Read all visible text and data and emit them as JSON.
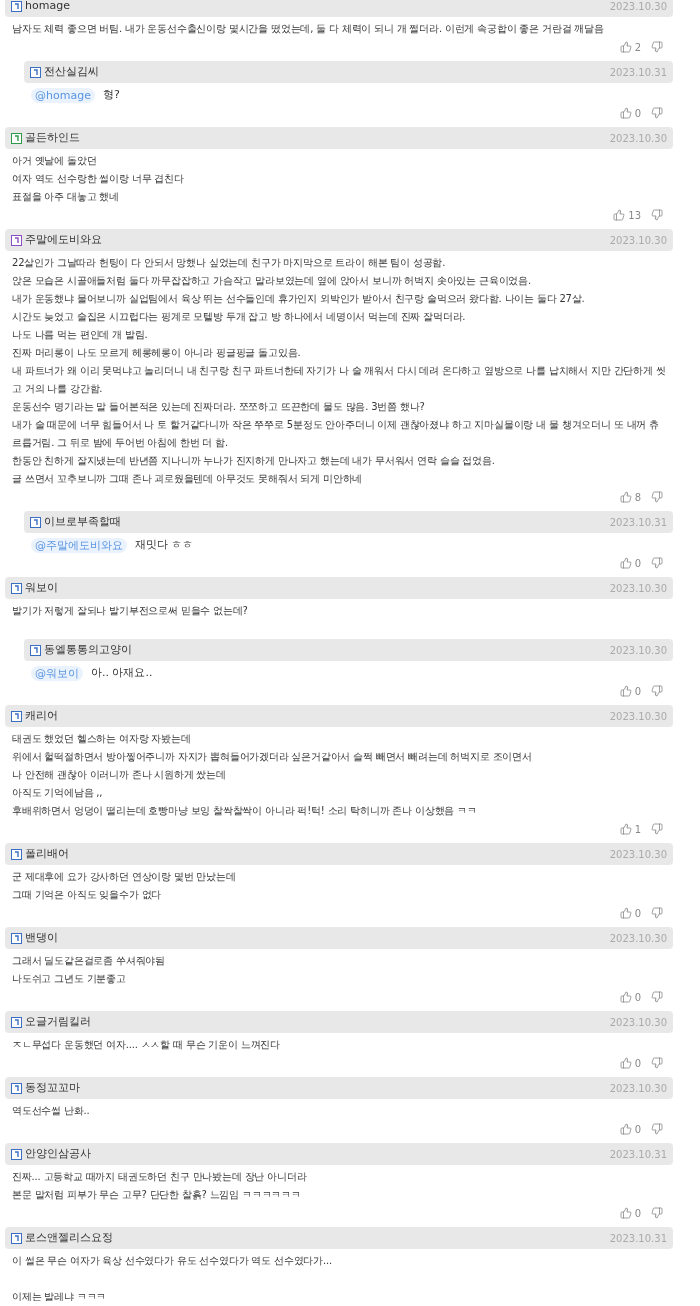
{
  "comments": [
    {
      "author": {
        "name": "homage",
        "color": "#3b6fc4"
      },
      "date": "2023.10.30",
      "lines": [
        "남자도 체력 좋으면 버팀. 내가 운동선수출신이랑 몇시간을 떴었는데, 둘 다 체력이 되니 개 쩔더라. 이런게 속궁합이 좋은 거란걸 깨달음"
      ],
      "likes": "2",
      "replies": [
        {
          "author": {
            "name": "전산실김씨",
            "color": "#3b6fc4"
          },
          "date": "2023.10.31",
          "mention": "@homage",
          "text": "형?",
          "likes": "0"
        }
      ]
    },
    {
      "author": {
        "name": "골든하인드",
        "color": "#2e9b4a"
      },
      "date": "2023.10.30",
      "lines": [
        "아거 옛날에 돌았던",
        "여자 역도 선수랑한 썰이랑 너무 겹친다",
        "표절을 아주 대놓고 했네"
      ],
      "likes": "13"
    },
    {
      "author": {
        "name": "주말에도비와요",
        "color": "#8a4fc4"
      },
      "date": "2023.10.30",
      "lines": [
        "22살인가 그날따라 헌팅이 다 안되서 망했나 싶었는데 친구가 마지막으로 트라이 해본 팀이 성공함.",
        "앉은 모습은 시골애들처럼 둘다 까무잡잡하고 가슴작고 말라보였는데 옆에 앉아서 보니까 허벅지 솟아있는 근육이었음.",
        "내가 운동했냐 물어보니까 실업팀에서 육상 뛰는 선수들인데 휴가인지 외박인가 받아서 친구랑 술먹으러 왔다함. 나이는 둘다 27살.",
        "시간도 늦었고 술집은 시끄럽다는 핑계로 모텔방 두개 잡고 방 하나에서 네명이서 먹는데 진짜 잘먹더라.",
        "나도 나름 먹는 편인데 개 발림.",
        "진짜 머리롱이 나도 모르게 헤롱헤롱이 아니라 핑글핑글 돌고있음.",
        "내 파트너가 왜 이리 못먹냐고 놀리더니 내 친구랑 친구 파트너한테 자기가 나 술 깨워서 다시 데려 온다하고 옆방으로 나를 납치해서 지만 간단하게 씻고 거의 나를 강간함.",
        "운동선수 명기라는 말 들어본적은 있는데 진짜더라. 쪼쪼하고 뜨끈한데 물도 많음. 3번쯤 했나?",
        "내가 술 때문에 너무 힘들어서 나 토 할거같다니까 작은 쭈쭈로 5분정도 안아주더니 이제 괜찮아졌냐 하고 지마실물이랑 내 물 챙겨오더니 또 내꺼 츄르릅거림. 그 뒤로 밤에 두어번 아침에 한번 더 함.",
        "한동안 친하게 잘지냈는데 반년쯤 지나니까 누나가 진지하게 만나자고 했는데 내가 무서워서 연락 슬슬 접었음.",
        "글 쓰면서 꼬추보니까 그때 존나 괴로웠을텐데 아무것도 못해줘서 되게 미안하네"
      ],
      "likes": "8",
      "replies": [
        {
          "author": {
            "name": "이브로부족할때",
            "color": "#3b6fc4"
          },
          "date": "2023.10.31",
          "mention": "@주말에도비와요",
          "text": "재밋다 ㅎㅎ",
          "likes": "0"
        }
      ]
    },
    {
      "author": {
        "name": "워보이",
        "color": "#3b6fc4"
      },
      "date": "2023.10.30",
      "lines": [
        "발기가 저렇게 잘되나 발기부전으로써 믿을수 없는데?"
      ],
      "replies": [
        {
          "author": {
            "name": "동엘통통의고양이",
            "color": "#3b6fc4"
          },
          "date": "2023.10.30",
          "mention": "@워보이",
          "text": "아.. 아재요..",
          "likes": "0"
        }
      ]
    },
    {
      "author": {
        "name": "캐리어",
        "color": "#3b6fc4"
      },
      "date": "2023.10.30",
      "lines": [
        "태권도 했었던 헬스하는 여자랑 자봤는데",
        "위에서 헐떡절하면서 방아찧어주니까 자지가 뽑혀들어가겠더라 싶은거같아서 슬쩍 빼면서 빼려는데 허벅지로 조이면서",
        "나 안전해 괜찮아 이러니까 존나 시원하게 쌌는데",
        "아직도 기억에남음 ,,",
        "후배위하면서 엉덩이 떨리는데 호빵마냥 보잉 찰싹찰싹이 아니라 퍽!턱! 소리 탁히니까 존나 이상했음 ㅋㅋ"
      ],
      "likes": "1"
    },
    {
      "author": {
        "name": "폴리배어",
        "color": "#3b6fc4"
      },
      "date": "2023.10.30",
      "lines": [
        "군 제대후에 요가 강사하던 연상이랑 몇번 만났는데",
        "그때 기억은 아직도 잊을수가 없다"
      ],
      "likes": "0"
    },
    {
      "author": {
        "name": "밴댕이",
        "color": "#3b6fc4"
      },
      "date": "2023.10.30",
      "lines": [
        "그래서 딜도같은걸로좀 쑤셔줘야됨",
        "나도쉬고 그년도 기분좋고"
      ],
      "likes": "0"
    },
    {
      "author": {
        "name": "오글거림킬러",
        "color": "#3b6fc4"
      },
      "date": "2023.10.30",
      "lines": [
        "ㅈㄴ무섭다 운동했던 여자.... ㅅㅅ할 때 무슨 기운이 느껴진다"
      ],
      "likes": "0"
    },
    {
      "author": {
        "name": "동정꼬꼬마",
        "color": "#3b6fc4"
      },
      "date": "2023.10.30",
      "lines": [
        "역도선수썰 난화.."
      ],
      "likes": "0"
    },
    {
      "author": {
        "name": "안양인삼공사",
        "color": "#3b6fc4"
      },
      "date": "2023.10.31",
      "lines": [
        "진짜... 고등학교 때까지 태권도하던 친구 만나봤는데 장난 아니더라",
        "본문 말처럼 피부가 무슨 고무? 단단한 찰흙? 느낌임 ㅋㅋㅋㅋㅋㅋ"
      ],
      "likes": "0"
    },
    {
      "author": {
        "name": "로스앤젤리스요정",
        "color": "#3b6fc4"
      },
      "date": "2023.10.31",
      "paragraphs": [
        [
          "이 썰은 무슨 여자가 육상 선수였다가 유도 선수였다가 역도 선수였다가..."
        ],
        [
          "이제는 발레냐 ㅋㅋㅋ"
        ]
      ]
    }
  ]
}
